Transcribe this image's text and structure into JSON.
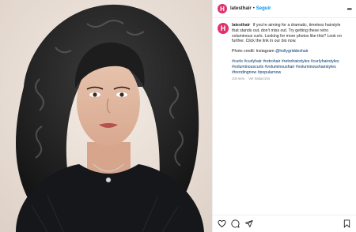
{
  "header": {
    "avatar_letter": "H",
    "username": "latesthair",
    "separator": "•",
    "follow_label": "Seguir",
    "more_label": "•••"
  },
  "caption": {
    "avatar_letter": "H",
    "username": "latesthair",
    "text": "If you're aiming for a dramatic, timeless hairstyle that stands out, don't miss out. Try getting these retro voluminous curls. Looking for more photos like this? Look no further. Click the link in our bio now.",
    "credit_prefix": "Photo credit: Instagram ",
    "credit_handle": "@hollygriddeshair",
    "hashtags": "#curls #curlyhair #retrohair #retrohairstyles #curlyhairstyles #voluminouscurls #voluminoushair #voluminoushairstyles #trendingnow #popularnow",
    "time": "104 sem",
    "translation": "Ver traducción"
  },
  "actions": {
    "like_icon": "heart-icon",
    "comment_icon": "comment-icon",
    "share_icon": "share-icon",
    "save_icon": "bookmark-icon"
  },
  "colors": {
    "brand": "#e1306c",
    "link": "#0095f6",
    "hashtag": "#00376b"
  }
}
